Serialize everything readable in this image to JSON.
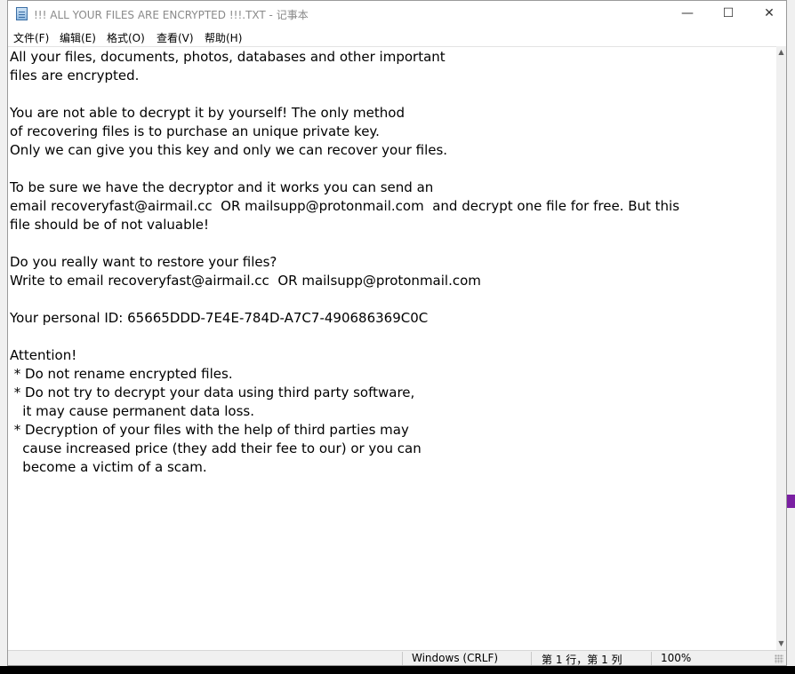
{
  "window": {
    "title": "!!! ALL YOUR FILES ARE ENCRYPTED !!!.TXT - 记事本"
  },
  "menu": {
    "items": [
      {
        "label": "文件(F)"
      },
      {
        "label": "编辑(E)"
      },
      {
        "label": "格式(O)"
      },
      {
        "label": "查看(V)"
      },
      {
        "label": "帮助(H)"
      }
    ]
  },
  "editor": {
    "text": "All your files, documents, photos, databases and other important\nfiles are encrypted.\n\nYou are not able to decrypt it by yourself! The only method\nof recovering files is to purchase an unique private key.\nOnly we can give you this key and only we can recover your files.\n\nTo be sure we have the decryptor and it works you can send an\nemail recoveryfast@airmail.cc  OR mailsupp@protonmail.com  and decrypt one file for free. But this\nfile should be of not valuable!\n\nDo you really want to restore your files?\nWrite to email recoveryfast@airmail.cc  OR mailsupp@protonmail.com\n\nYour personal ID: 65665DDD-7E4E-784D-A7C7-490686369C0C\n\nAttention!\n * Do not rename encrypted files.\n * Do not try to decrypt your data using third party software,\n   it may cause permanent data loss.\n * Decryption of your files with the help of third parties may\n   cause increased price (they add their fee to our) or you can\n   become a victim of a scam."
  },
  "status": {
    "line_ending": "Windows (CRLF)",
    "cursor_position": "第 1 行，第 1 列",
    "zoom": "100%"
  },
  "icons": {
    "app": "notepad-icon",
    "minimize": "minimize-icon",
    "maximize": "maximize-icon",
    "close": "close-icon"
  }
}
